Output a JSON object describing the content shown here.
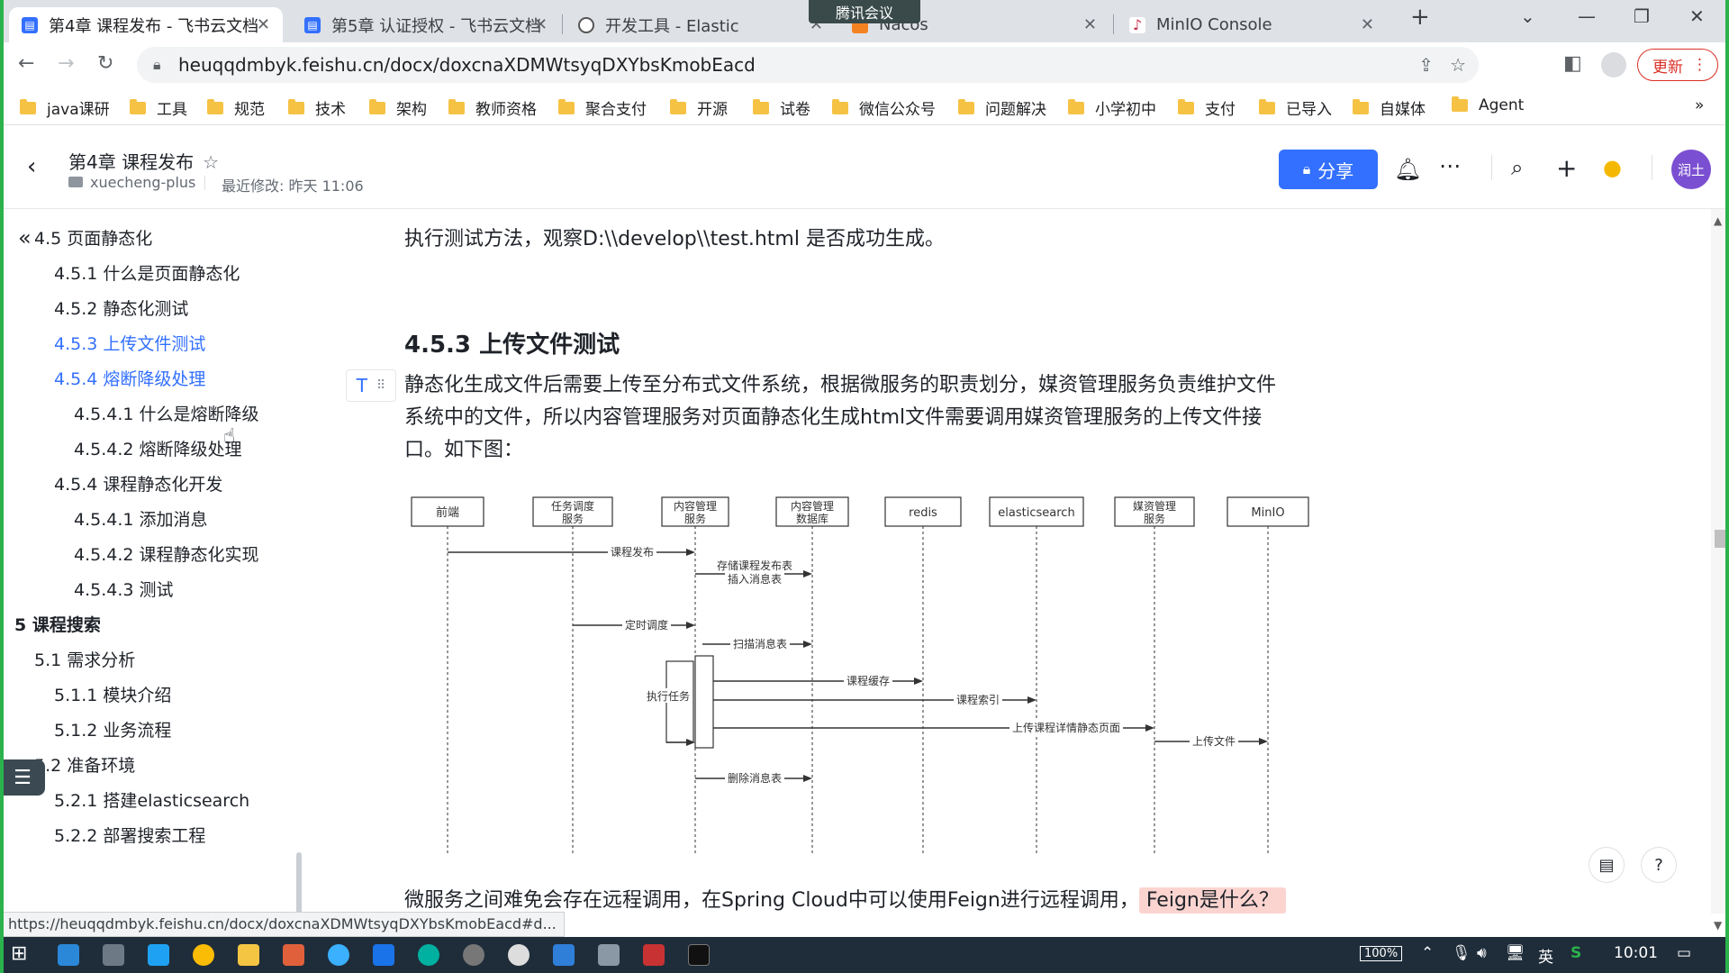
{
  "browser": {
    "tabs": [
      {
        "title": "第4章 课程发布 - 飞书云文档",
        "active": true
      },
      {
        "title": "第5章 认证授权 - 飞书云文档",
        "active": false
      },
      {
        "title": "开发工具 - Elastic",
        "active": false
      },
      {
        "title": "Nacos",
        "active": false
      },
      {
        "title": "MinIO Console",
        "active": false
      }
    ],
    "overlay_meeting": "腾讯会议",
    "url": "heuqqdmbyk.feishu.cn/docx/doxcnaXDMWtsyqDXYbsKmobEacd",
    "update_label": "更新",
    "bookmarks": [
      "java课研",
      "工具",
      "规范",
      "技术",
      "架构",
      "教师资格",
      "聚合支付",
      "开源",
      "试卷",
      "微信公众号",
      "问题解决",
      "小学初中",
      "支付",
      "已导入",
      "自媒体",
      "Agent"
    ],
    "status_url": "https://heuqqdmbyk.feishu.cn/docx/doxcnaXDMWtsyqDXYbsKmobEacd#d..."
  },
  "doc": {
    "title": "第4章 课程发布",
    "space": "xuecheng-plus",
    "modified": "最近修改: 昨天 11:06",
    "share_label": "分享",
    "avatar_text": "润土",
    "intro_line": "执行测试方法，观察D:\\\\develop\\\\test.html 是否成功生成。",
    "heading": "4.5.3 上传文件测试",
    "para_lines": [
      "静态化生成文件后需要上传至分布式文件系统，根据微服务的职责划分，媒资管理服务负责维护文件",
      "系统中的文件，所以内容管理服务对页面静态化生成html文件需要调用媒资管理服务的上传文件接",
      "口。如下图："
    ],
    "bottom_line": "微服务之间难免会存在远程调用，在Spring Cloud中可以使用Feign进行远程调用，",
    "bottom_highlight": "Feign是什么？"
  },
  "toc": [
    {
      "text": "4.5 页面静态化",
      "level": 1,
      "active": false
    },
    {
      "text": "4.5.1 什么是页面静态化",
      "level": 2,
      "active": false
    },
    {
      "text": "4.5.2 静态化测试",
      "level": 2,
      "active": false
    },
    {
      "text": "4.5.3 上传文件测试",
      "level": 2,
      "active": true
    },
    {
      "text": "4.5.4 熔断降级处理",
      "level": 2,
      "active": true
    },
    {
      "text": "4.5.4.1 什么是熔断降级",
      "level": 3,
      "active": false
    },
    {
      "text": "4.5.4.2 熔断降级处理",
      "level": 3,
      "active": false
    },
    {
      "text": "4.5.4 课程静态化开发",
      "level": 2,
      "active": false
    },
    {
      "text": "4.5.4.1 添加消息",
      "level": 3,
      "active": false
    },
    {
      "text": "4.5.4.2 课程静态化实现",
      "level": 3,
      "active": false
    },
    {
      "text": "4.5.4.3 测试",
      "level": 3,
      "active": false
    },
    {
      "text": "5 课程搜索",
      "level": 0,
      "active": false
    },
    {
      "text": "5.1 需求分析",
      "level": 1,
      "active": false
    },
    {
      "text": "5.1.1 模块介绍",
      "level": 2,
      "active": false
    },
    {
      "text": "5.1.2 业务流程",
      "level": 2,
      "active": false
    },
    {
      "text": "5.2 准备环境",
      "level": 1,
      "active": false
    },
    {
      "text": "5.2.1 搭建elasticsearch",
      "level": 2,
      "active": false
    },
    {
      "text": "5.2.2 部署搜索工程",
      "level": 2,
      "active": false
    }
  ],
  "diagram": {
    "participants": [
      "前端",
      "任务调度服务",
      "内容管理服务",
      "内容管理数据库",
      "redis",
      "elasticsearch",
      "媒资管理服务",
      "MinIO"
    ],
    "messages": [
      "课程发布",
      "存储课程发布表",
      "插入消息表",
      "定时调度",
      "扫描消息表",
      "执行任务",
      "课程缓存",
      "课程索引",
      "上传课程详情静态页面",
      "上传文件",
      "删除消息表"
    ]
  },
  "taskbar": {
    "battery": "100%",
    "ime": "英",
    "time": "10:01"
  }
}
